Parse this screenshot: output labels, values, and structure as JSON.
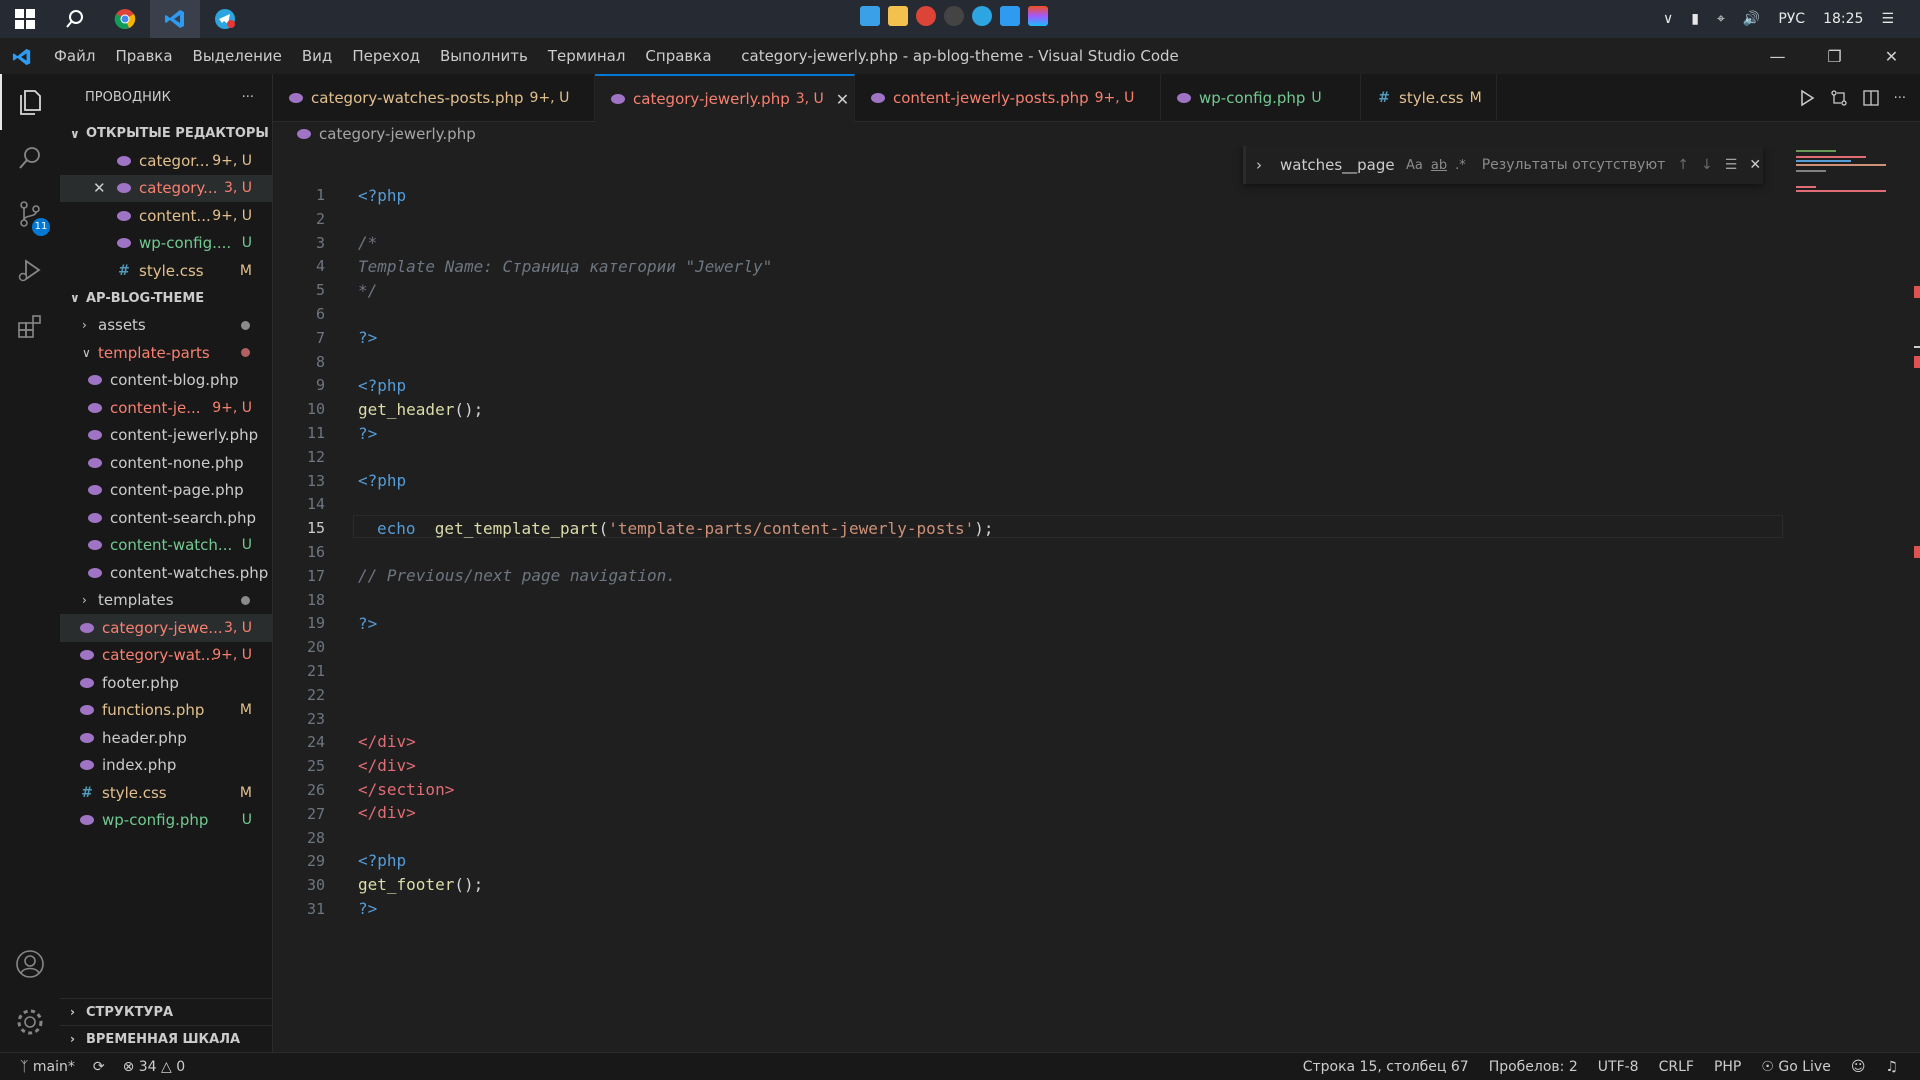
{
  "taskbar": {
    "lang": "РУС",
    "time": "18:25"
  },
  "titlebar": {
    "menu": [
      "Файл",
      "Правка",
      "Выделение",
      "Вид",
      "Переход",
      "Выполнить",
      "Терминал",
      "Справка"
    ],
    "title": "category-jewerly.php - ap-blog-theme - Visual Studio Code"
  },
  "activity": {
    "scm_badge": "11"
  },
  "sidebar": {
    "header": "ПРОВОДНИК",
    "more": "···",
    "open_editors_title": "ОТКРЫТЫЕ РЕДАКТОРЫ",
    "open_editors": [
      {
        "name": "categor...",
        "status": "9+, U",
        "icon": "php"
      },
      {
        "name": "category...",
        "status": "3, U",
        "icon": "php"
      },
      {
        "name": "content...",
        "status": "9+, U",
        "icon": "php"
      },
      {
        "name": "wp-config....",
        "status": "U",
        "icon": "php"
      },
      {
        "name": "style.css",
        "status": "M",
        "icon": "css"
      }
    ],
    "project_title": "AP-BLOG-THEME",
    "tree": {
      "assets": "assets",
      "template_parts": "template-parts",
      "tp_files": [
        {
          "name": "content-blog.php",
          "status": ""
        },
        {
          "name": "content-je...",
          "status": "9+, U"
        },
        {
          "name": "content-jewerly.php",
          "status": ""
        },
        {
          "name": "content-none.php",
          "status": ""
        },
        {
          "name": "content-page.php",
          "status": ""
        },
        {
          "name": "content-search.php",
          "status": ""
        },
        {
          "name": "content-watch...",
          "status": "U"
        },
        {
          "name": "content-watches.php",
          "status": ""
        }
      ],
      "templates": "templates",
      "root_files": [
        {
          "name": "category-jewe...",
          "status": "3, U",
          "icon": "php"
        },
        {
          "name": "category-wat...",
          "status": "9+, U",
          "icon": "php"
        },
        {
          "name": "footer.php",
          "status": "",
          "icon": "php"
        },
        {
          "name": "functions.php",
          "status": "M",
          "icon": "php"
        },
        {
          "name": "header.php",
          "status": "",
          "icon": "php"
        },
        {
          "name": "index.php",
          "status": "",
          "icon": "php"
        },
        {
          "name": "style.css",
          "status": "M",
          "icon": "css"
        },
        {
          "name": "wp-config.php",
          "status": "U",
          "icon": "php"
        }
      ]
    },
    "outline": "СТРУКТУРА",
    "timeline": "ВРЕМЕННАЯ ШКАЛА"
  },
  "tabs": [
    {
      "name": "category-watches-posts.php",
      "status": "9+, U"
    },
    {
      "name": "category-jewerly.php",
      "status": "3, U"
    },
    {
      "name": "content-jewerly-posts.php",
      "status": "9+, U"
    },
    {
      "name": "wp-config.php",
      "status": "U"
    },
    {
      "name": "style.css",
      "status": "M"
    }
  ],
  "breadcrumb": "category-jewerly.php",
  "find": {
    "value": "watches__page",
    "case": "Aa",
    "word": "ab",
    "regex": ".*",
    "results": "Результаты отсутствуют"
  },
  "code": {
    "line_numbers": [
      "1",
      "2",
      "3",
      "4",
      "5",
      "6",
      "7",
      "8",
      "9",
      "10",
      "11",
      "12",
      "13",
      "14",
      "15",
      "16",
      "17",
      "18",
      "19",
      "20",
      "21",
      "22",
      "23",
      "24",
      "25",
      "26",
      "27",
      "28",
      "29",
      "30",
      "31"
    ],
    "l1": "<?php",
    "l3": "/*",
    "l4": "Template Name: Страница категории \"Jewerly\"",
    "l5": "*/",
    "l7": "?>",
    "l9": "<?php",
    "l10_fn": "get_header",
    "l10_rest": "();",
    "l11": "?>",
    "l13": "<?php",
    "l15_kw": "echo",
    "l15_fn": "get_template_part",
    "l15_open": "(",
    "l15_str": "'template-parts/content-jewerly-posts'",
    "l15_close": ");",
    "l17": "// Previous/next page navigation.",
    "l19": "?>",
    "l24": "</div>",
    "l25": "</div>",
    "l26": "</section>",
    "l27": "</div>",
    "l29": "<?php",
    "l30_fn": "get_footer",
    "l30_rest": "();",
    "l31": "?>"
  },
  "status": {
    "branch": "main*",
    "errors": "34",
    "warnings": "0",
    "position": "Строка 15, столбец 67",
    "spaces": "Пробелов: 2",
    "encoding": "UTF-8",
    "eol": "CRLF",
    "language": "PHP",
    "golive": "Go Live"
  }
}
